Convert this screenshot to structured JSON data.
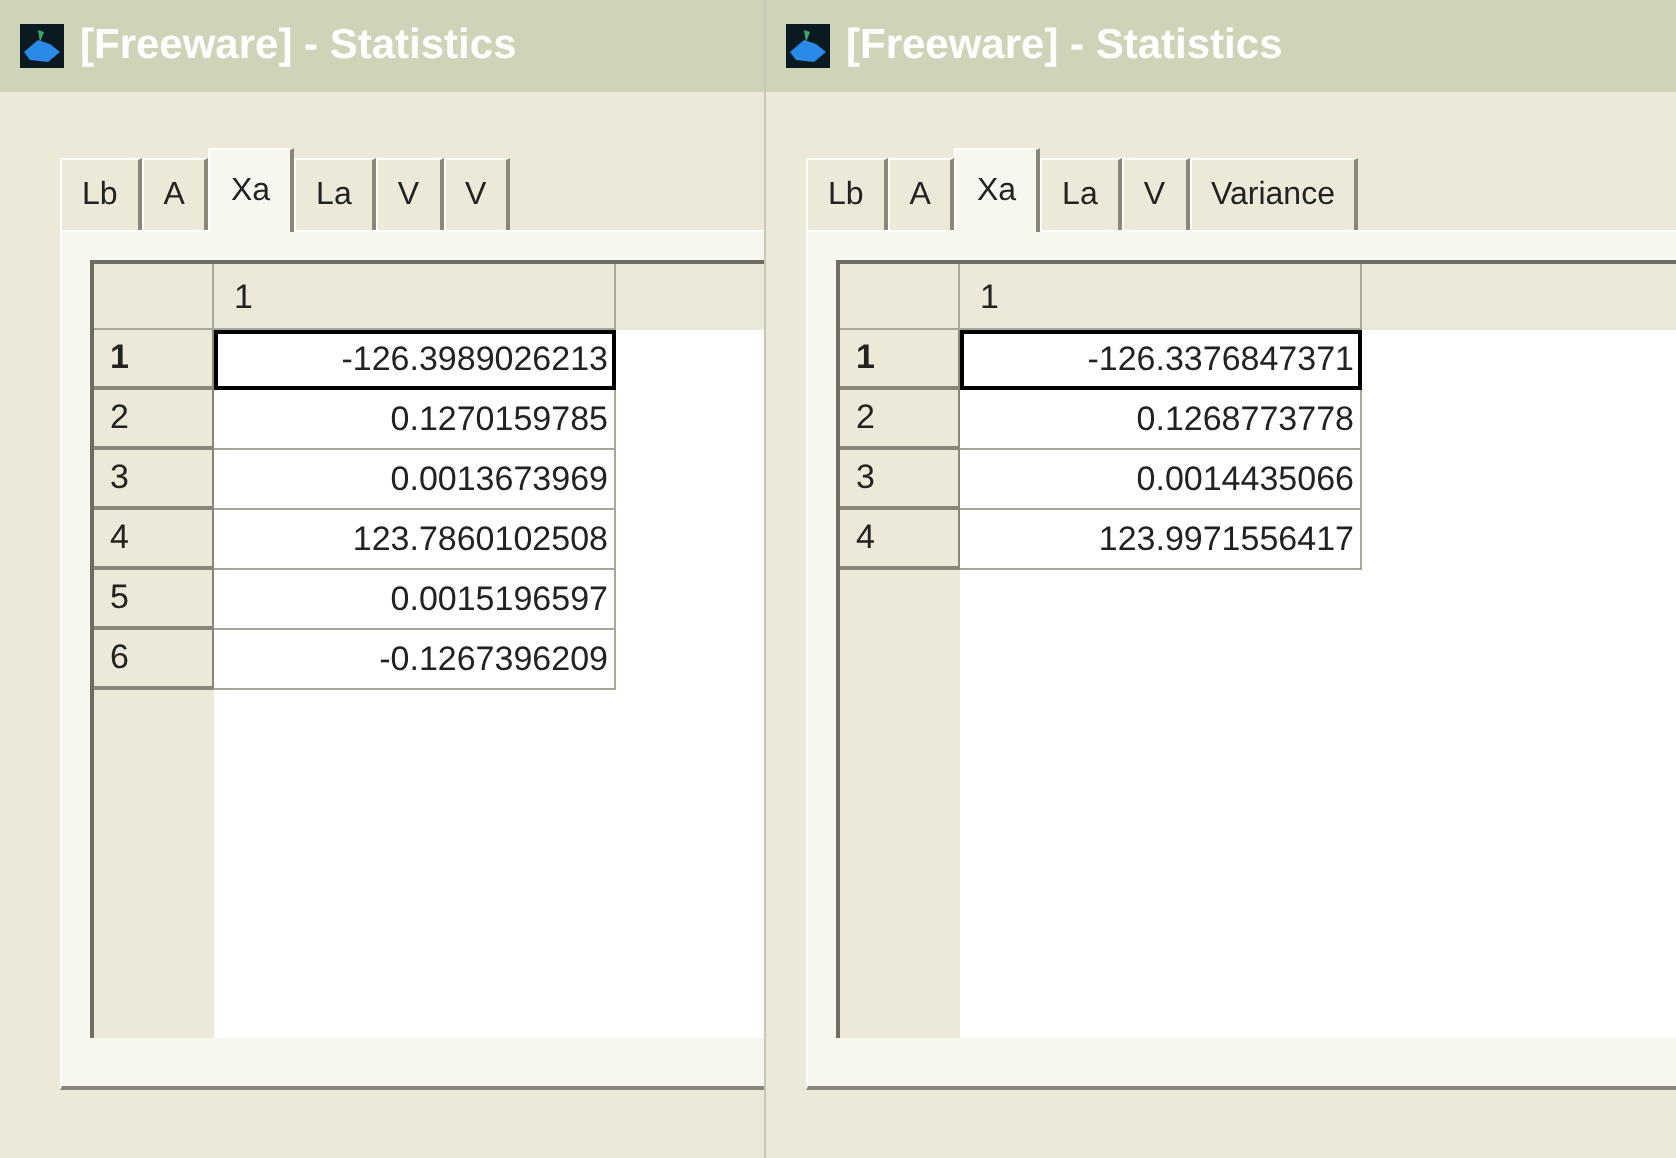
{
  "windows": [
    {
      "title": "[Freeware] - Statistics",
      "tabs": [
        {
          "label": "Lb",
          "selected": false
        },
        {
          "label": "A",
          "selected": false
        },
        {
          "label": "Xa",
          "selected": true
        },
        {
          "label": "La",
          "selected": false
        },
        {
          "label": "V",
          "selected": false
        },
        {
          "label": "V",
          "selected": false
        }
      ],
      "grid": {
        "columns": [
          "1"
        ],
        "rows": [
          {
            "header": "1",
            "value": "-126.3989026213",
            "selected": true
          },
          {
            "header": "2",
            "value": "0.1270159785",
            "selected": false
          },
          {
            "header": "3",
            "value": "0.0013673969",
            "selected": false
          },
          {
            "header": "4",
            "value": "123.7860102508",
            "selected": false
          },
          {
            "header": "5",
            "value": "0.0015196597",
            "selected": false
          },
          {
            "header": "6",
            "value": "-0.1267396209",
            "selected": false
          }
        ]
      }
    },
    {
      "title": "[Freeware] - Statistics",
      "tabs": [
        {
          "label": "Lb",
          "selected": false
        },
        {
          "label": "A",
          "selected": false
        },
        {
          "label": "Xa",
          "selected": true
        },
        {
          "label": "La",
          "selected": false
        },
        {
          "label": "V",
          "selected": false
        },
        {
          "label": "Variance",
          "selected": false
        }
      ],
      "grid": {
        "columns": [
          "1"
        ],
        "rows": [
          {
            "header": "1",
            "value": "-126.3376847371",
            "selected": true
          },
          {
            "header": "2",
            "value": "0.1268773778",
            "selected": false
          },
          {
            "header": "3",
            "value": "0.0014435066",
            "selected": false
          },
          {
            "header": "4",
            "value": "123.9971556417",
            "selected": false
          }
        ]
      }
    }
  ]
}
